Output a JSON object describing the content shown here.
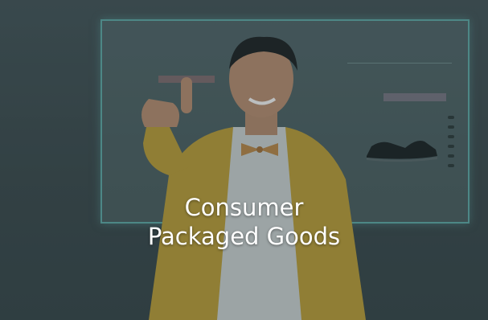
{
  "caption": {
    "line1": "Consumer",
    "line2": "Packaged Goods"
  },
  "colors": {
    "overlay": "#3c4b4e",
    "screen_border": "#5fa9a6",
    "jacket": "#d6b83e",
    "caption_text": "#ffffff"
  },
  "icons": [
    "sneaker-image",
    "pointing-finger"
  ]
}
